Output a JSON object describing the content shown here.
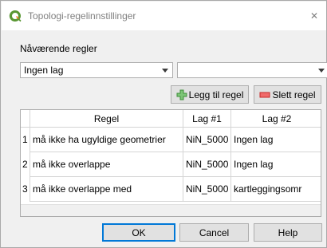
{
  "window": {
    "title": "Topologi-regelinnstillinger",
    "app_icon": "qgis-icon",
    "close_label": "✕"
  },
  "rules_section": {
    "label": "Nåværende regler",
    "layer1_combo_value": "Ingen lag",
    "layer2_combo_value": ""
  },
  "toolbar": {
    "add_label": "Legg til regel",
    "delete_label": "Slett regel",
    "add_icon": "plus-icon",
    "delete_icon": "minus-icon",
    "add_icon_color": "#4caf50",
    "delete_icon_color": "#e53935"
  },
  "table": {
    "headers": [
      "Regel",
      "Lag #1",
      "Lag #2"
    ],
    "rows": [
      {
        "num": "1",
        "regel": "må ikke ha ugyldige geometrier",
        "lag1": "NiN_5000",
        "lag2": "Ingen lag"
      },
      {
        "num": "2",
        "regel": "må ikke overlappe",
        "lag1": "NiN_5000",
        "lag2": "Ingen lag"
      },
      {
        "num": "3",
        "regel": "må ikke overlappe med",
        "lag1": "NiN_5000",
        "lag2": "kartleggingsomr"
      }
    ]
  },
  "buttons": {
    "ok": "OK",
    "cancel": "Cancel",
    "help": "Help"
  }
}
